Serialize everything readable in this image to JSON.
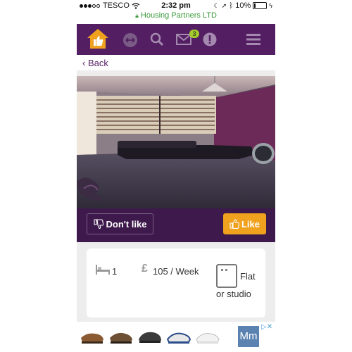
{
  "status_bar": {
    "carrier": "TESCO",
    "time": "2:32 pm",
    "battery": "10%"
  },
  "url_bar": {
    "site": "Housing Partners LTD"
  },
  "nav": {
    "inbox_count": "3"
  },
  "back": {
    "label": "Back"
  },
  "actions": {
    "dislike_label": "Don't like",
    "like_label": "Like"
  },
  "details": {
    "bedrooms": "1",
    "currency": "£",
    "rent": "105 / Week",
    "type_line1": "Flat",
    "type_line2": "or studio"
  },
  "ad": {
    "logo_text": "Mm"
  },
  "colors": {
    "nav_bg": "#541e63",
    "like": "#f0a11e",
    "badge": "#a4cc2a",
    "secure_green": "#3c9a3c"
  }
}
